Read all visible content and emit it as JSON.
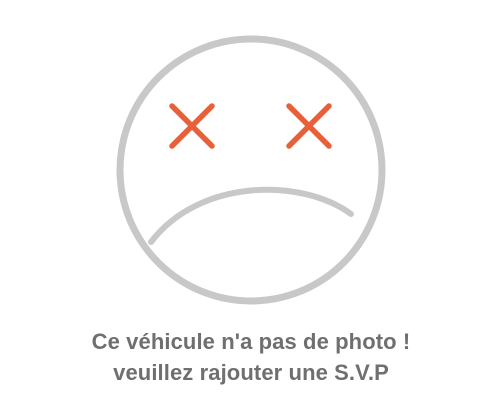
{
  "placeholder": {
    "message_line1": "Ce véhicule n'a pas de photo !",
    "message_line2": "veuillez rajouter une S.V.P"
  },
  "icons": {
    "face": "sad-face-icon",
    "left_eye": "x-mark-icon",
    "right_eye": "x-mark-icon"
  },
  "colors": {
    "background": "#ffffff",
    "face_outline": "#c8c8c8",
    "eyes": "#e8603a",
    "mouth": "#c8c8c8",
    "text": "#6f6f6f"
  }
}
